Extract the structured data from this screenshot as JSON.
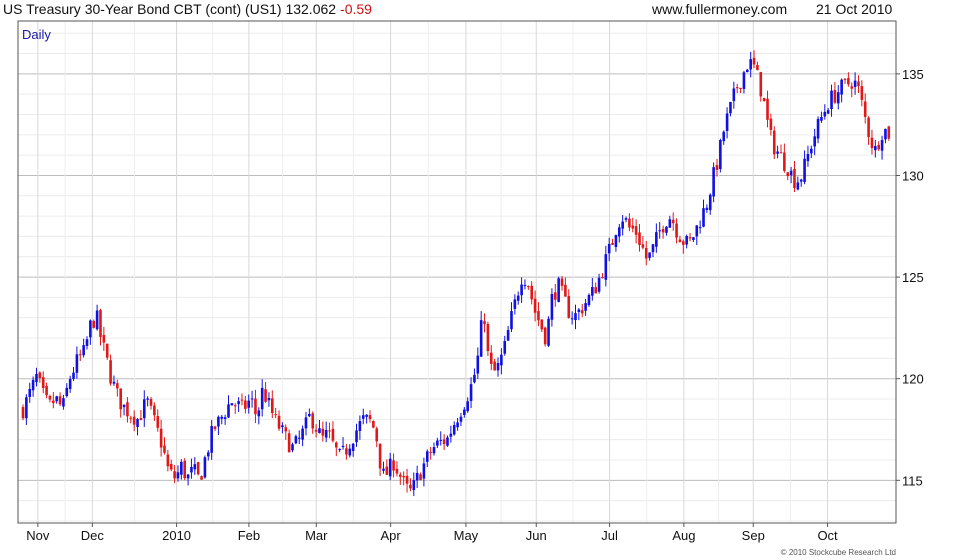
{
  "header": {
    "title": "US Treasury 30-Year  Bond CBT (cont) (US1) 132.062",
    "change": "-0.59",
    "source": "www.fullermoney.com",
    "date": "21 Oct 2010"
  },
  "colors": {
    "up": "#1010e0",
    "down": "#e01818",
    "grid": "#d6d6d6",
    "change_text": "#cc1111"
  },
  "chart_data": {
    "type": "candlestick",
    "interval_label": "Daily",
    "copyright": "© 2010 Stockcube Research Ltd",
    "ylim": [
      112.9,
      137.6
    ],
    "yticks": [
      115,
      120,
      125,
      130,
      135
    ],
    "ytick_labels": [
      "115",
      "120",
      "125",
      "130",
      "135"
    ],
    "x_months": [
      {
        "label": "Nov",
        "index": 15
      },
      {
        "label": "Dec",
        "index": 70
      },
      {
        "label": "2010",
        "index": 155
      },
      {
        "label": "Feb",
        "index": 228
      },
      {
        "label": "Mar",
        "index": 296
      },
      {
        "label": "Apr",
        "index": 371
      },
      {
        "label": "May",
        "index": 447
      },
      {
        "label": "Jun",
        "index": 518
      },
      {
        "label": "Jul",
        "index": 592
      },
      {
        "label": "Aug",
        "index": 667
      },
      {
        "label": "Sep",
        "index": 737
      },
      {
        "label": "Oct",
        "index": 812
      }
    ],
    "x_count": 874,
    "grid": true,
    "legend": "none",
    "anchors": [
      [
        0,
        118.5
      ],
      [
        8,
        119.4
      ],
      [
        14,
        120.1
      ],
      [
        20,
        119.2
      ],
      [
        26,
        118.6
      ],
      [
        33,
        119.0
      ],
      [
        40,
        118.5
      ],
      [
        47,
        120.0
      ],
      [
        55,
        120.9
      ],
      [
        62,
        121.3
      ],
      [
        68,
        122.6
      ],
      [
        74,
        123.1
      ],
      [
        79,
        121.9
      ],
      [
        84,
        121.0
      ],
      [
        88,
        120.2
      ],
      [
        94,
        119.3
      ],
      [
        100,
        118.7
      ],
      [
        108,
        118.3
      ],
      [
        116,
        118.0
      ],
      [
        125,
        118.9
      ],
      [
        133,
        117.8
      ],
      [
        140,
        116.8
      ],
      [
        147,
        115.4
      ],
      [
        154,
        115.1
      ],
      [
        160,
        115.7
      ],
      [
        166,
        115.1
      ],
      [
        172,
        115.5
      ],
      [
        178,
        115.0
      ],
      [
        185,
        116.3
      ],
      [
        192,
        117.5
      ],
      [
        198,
        117.9
      ],
      [
        204,
        118.4
      ],
      [
        210,
        118.9
      ],
      [
        216,
        118.7
      ],
      [
        222,
        118.5
      ],
      [
        230,
        119.0
      ],
      [
        236,
        118.1
      ],
      [
        242,
        119.5
      ],
      [
        248,
        118.7
      ],
      [
        254,
        118.0
      ],
      [
        260,
        117.5
      ],
      [
        266,
        117.0
      ],
      [
        272,
        116.6
      ],
      [
        278,
        116.9
      ],
      [
        284,
        117.5
      ],
      [
        290,
        118.2
      ],
      [
        296,
        117.6
      ],
      [
        302,
        117.0
      ],
      [
        308,
        117.3
      ],
      [
        314,
        116.6
      ],
      [
        320,
        116.1
      ],
      [
        326,
        116.5
      ],
      [
        332,
        117.1
      ],
      [
        338,
        117.6
      ],
      [
        344,
        118.0
      ],
      [
        350,
        117.9
      ],
      [
        356,
        117.4
      ],
      [
        360,
        116.0
      ],
      [
        364,
        115.2
      ],
      [
        368,
        115.4
      ],
      [
        374,
        115.9
      ],
      [
        380,
        115.3
      ],
      [
        386,
        114.6
      ],
      [
        392,
        114.4
      ],
      [
        398,
        115.1
      ],
      [
        404,
        115.7
      ],
      [
        410,
        116.3
      ],
      [
        416,
        116.7
      ],
      [
        422,
        116.9
      ],
      [
        428,
        117.0
      ],
      [
        434,
        117.7
      ],
      [
        440,
        118.3
      ],
      [
        446,
        118.9
      ],
      [
        452,
        119.6
      ],
      [
        458,
        120.6
      ],
      [
        462,
        122.3
      ],
      [
        465,
        123.5
      ],
      [
        469,
        121.2
      ],
      [
        474,
        120.2
      ],
      [
        480,
        120.6
      ],
      [
        486,
        121.5
      ],
      [
        492,
        122.8
      ],
      [
        498,
        124.0
      ],
      [
        504,
        125.2
      ],
      [
        510,
        124.7
      ],
      [
        516,
        123.4
      ],
      [
        522,
        122.7
      ],
      [
        528,
        122.0
      ],
      [
        534,
        124.0
      ],
      [
        540,
        124.6
      ],
      [
        546,
        123.9
      ],
      [
        552,
        123.2
      ],
      [
        558,
        123.1
      ],
      [
        564,
        123.5
      ],
      [
        570,
        123.9
      ],
      [
        576,
        124.3
      ],
      [
        582,
        125.0
      ],
      [
        588,
        125.8
      ],
      [
        594,
        126.6
      ],
      [
        600,
        127.7
      ],
      [
        606,
        128.0
      ],
      [
        612,
        127.4
      ],
      [
        618,
        127.3
      ],
      [
        624,
        126.6
      ],
      [
        630,
        125.8
      ],
      [
        636,
        126.4
      ],
      [
        642,
        127.2
      ],
      [
        648,
        127.8
      ],
      [
        654,
        128.0
      ],
      [
        660,
        127.3
      ],
      [
        666,
        126.8
      ],
      [
        672,
        126.6
      ],
      [
        678,
        127.2
      ],
      [
        684,
        127.9
      ],
      [
        690,
        128.6
      ],
      [
        696,
        129.8
      ],
      [
        702,
        130.9
      ],
      [
        708,
        132.4
      ],
      [
        714,
        133.3
      ],
      [
        720,
        134.3
      ],
      [
        726,
        134.9
      ],
      [
        732,
        135.6
      ],
      [
        738,
        135.3
      ],
      [
        744,
        134.4
      ],
      [
        748,
        133.5
      ],
      [
        752,
        132.4
      ],
      [
        756,
        131.6
      ],
      [
        760,
        131.3
      ],
      [
        766,
        130.8
      ],
      [
        772,
        130.4
      ],
      [
        778,
        129.8
      ],
      [
        784,
        129.8
      ],
      [
        790,
        130.6
      ],
      [
        796,
        131.6
      ],
      [
        802,
        132.4
      ],
      [
        808,
        133.1
      ],
      [
        814,
        133.7
      ],
      [
        820,
        134.0
      ],
      [
        826,
        134.3
      ],
      [
        832,
        134.5
      ],
      [
        838,
        134.7
      ],
      [
        844,
        134.1
      ],
      [
        848,
        133.2
      ],
      [
        852,
        132.4
      ],
      [
        856,
        131.7
      ],
      [
        860,
        131.2
      ],
      [
        864,
        131.8
      ],
      [
        868,
        132.3
      ],
      [
        874,
        132.062
      ]
    ]
  }
}
